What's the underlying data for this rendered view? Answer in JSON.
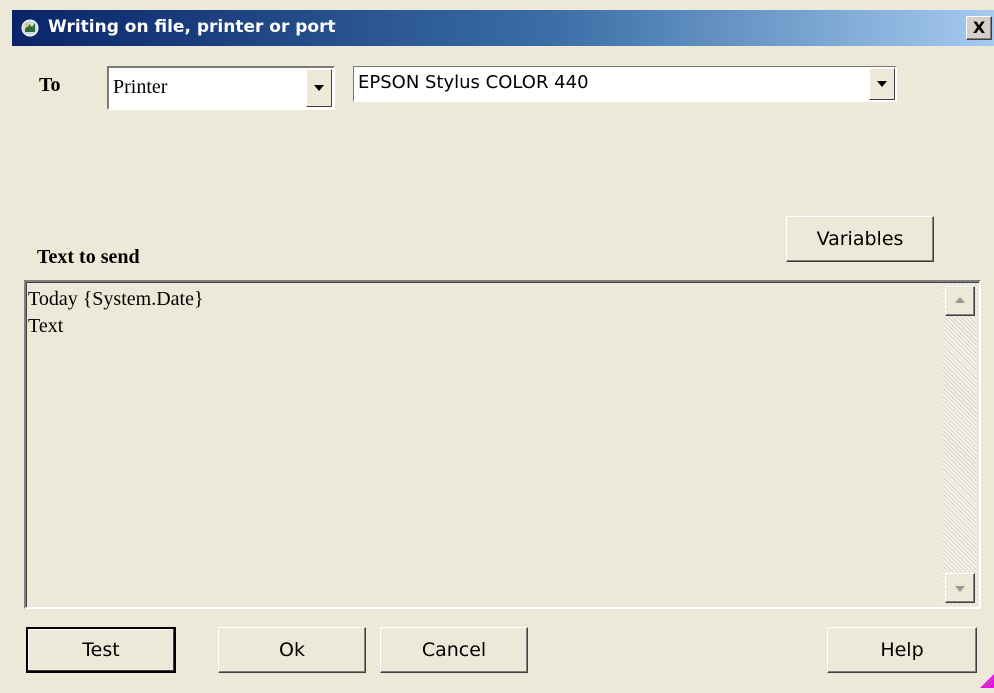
{
  "window": {
    "title": "Writing on file, printer or port",
    "close_glyph": "X"
  },
  "to_row": {
    "label": "To",
    "type_select": {
      "value": "Printer"
    },
    "device_select": {
      "value": "EPSON Stylus COLOR 440"
    }
  },
  "variables_button": {
    "label": "Variables"
  },
  "text_section": {
    "label": "Text to send",
    "lines": [
      "Today {System.Date}",
      "Text"
    ]
  },
  "buttons": {
    "test": "Test",
    "ok": "Ok",
    "cancel": "Cancel",
    "help": "Help"
  },
  "icons": {
    "window": "app-icon",
    "close": "close-icon",
    "dropdown": "chevron-down-icon",
    "scroll_up": "scroll-up-arrow-icon",
    "scroll_down": "scroll-down-arrow-icon",
    "resize": "resize-grip-icon"
  },
  "colors": {
    "title_bar_start": "#0a246a",
    "title_bar_end": "#a6caf0",
    "dialog_bg": "#ece9d8",
    "grip_accent": "#ff00ff"
  }
}
